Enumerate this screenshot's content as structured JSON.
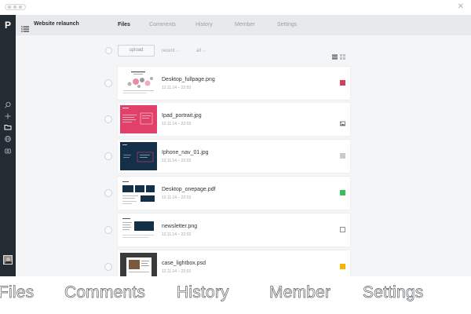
{
  "app": {
    "logo": "P",
    "project_title": "Website relaunch"
  },
  "tabs": [
    {
      "label": "Files",
      "active": true
    },
    {
      "label": "Comments",
      "active": false
    },
    {
      "label": "History",
      "active": false
    },
    {
      "label": "Member",
      "active": false
    },
    {
      "label": "Settings",
      "active": false
    }
  ],
  "toolbar": {
    "upload_label": "upload",
    "sort_value": "recent",
    "filter_value": "all"
  },
  "sidebar_icons": [
    "search-icon",
    "plus-icon",
    "folder-icon",
    "globe-icon",
    "archive-icon"
  ],
  "files": [
    {
      "name": "Desktop_fullpage.png",
      "date": "12.11.14 – 22:03",
      "status": "red",
      "status_color": "#d63c5e"
    },
    {
      "name": "Ipad_portrait.jpg",
      "date": "12.11.14 – 22:03",
      "status": "image",
      "status_color": "#555555"
    },
    {
      "name": "Iphone_nav_01.jpg",
      "date": "12.11.14 – 22:03",
      "status": "grey",
      "status_color": "#c6cbd0"
    },
    {
      "name": "Desktop_onepage.pdf",
      "date": "12.11.14 – 22:03",
      "status": "green",
      "status_color": "#3cbf5b"
    },
    {
      "name": "newsletter.png",
      "date": "12.11.14 – 22:03",
      "status": "empty",
      "status_color": "#ffffff"
    },
    {
      "name": "case_lightbox.psd",
      "date": "12.11.14 – 22:03",
      "status": "yellow",
      "status_color": "#f5b400"
    }
  ],
  "bottom_tabs": [
    "Files",
    "Comments",
    "History",
    "Member",
    "Settings"
  ],
  "colors": {
    "sidebar": "#232b33",
    "accent_pink": "#e0406a",
    "navy_thumb": "#143049"
  }
}
